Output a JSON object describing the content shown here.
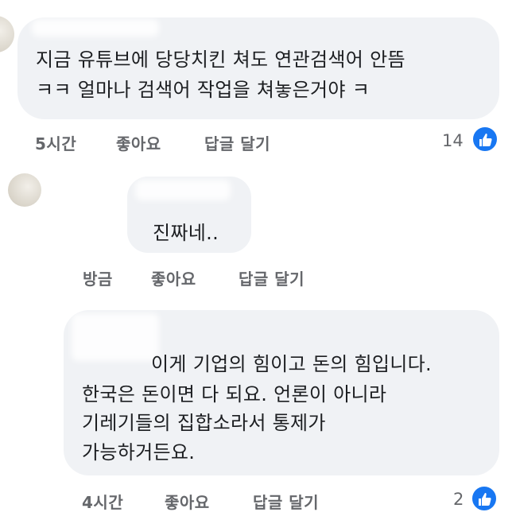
{
  "comments": [
    {
      "lines": [
        "지금 유튜브에 당당치킨 쳐도 연관검색어 안뜸",
        "ㅋㅋ 얼마나 검색어 작업을 쳐놓은거야 ㅋ"
      ],
      "time": "5시간",
      "like_label": "좋아요",
      "reply_label": "답글 달기",
      "reaction_count": "14"
    },
    {
      "lines": [
        "진짜네.."
      ],
      "time": "방금",
      "like_label": "좋아요",
      "reply_label": "답글 달기"
    },
    {
      "lines": [
        "이게 기업의 힘이고 돈의 힘입니다.",
        "한국은 돈이면 다 되요. 언론이 아니라",
        "기레기들의 집합소라서 통제가",
        "가능하거든요."
      ],
      "time": "4시간",
      "like_label": "좋아요",
      "reply_label": "답글 달기",
      "reaction_count": "2"
    }
  ],
  "colors": {
    "bubble": "#f0f2f5",
    "meta_text": "#65676b",
    "like_blue": "#1877f2"
  },
  "icons": {
    "reaction": "thumbs-up-icon"
  }
}
